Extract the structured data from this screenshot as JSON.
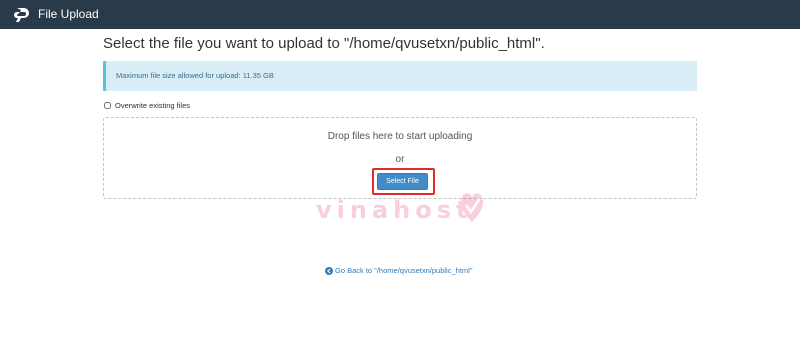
{
  "header": {
    "app_title": "File Upload",
    "logo_icon": "cpanel-logo-icon",
    "background_color": "#293a4a"
  },
  "main": {
    "page_title": "Select the file you want to upload to \"/home/qvusetxn/public_html\".",
    "info_alert": "Maximum file size allowed for upload: 11.35 GB",
    "overwrite_label": "Overwrite existing files",
    "overwrite_checked": false,
    "dropzone": {
      "drop_text": "Drop files here to start uploading",
      "or_text": "or",
      "select_file_label": "Select File",
      "button_color": "#428bca",
      "highlight_color": "#e02b2b"
    },
    "back_link": {
      "icon": "arrow-circle-left-icon",
      "label": "Go Back to \"/home/qvusetxn/public_html\""
    }
  },
  "watermark": {
    "text": "vinahost"
  }
}
